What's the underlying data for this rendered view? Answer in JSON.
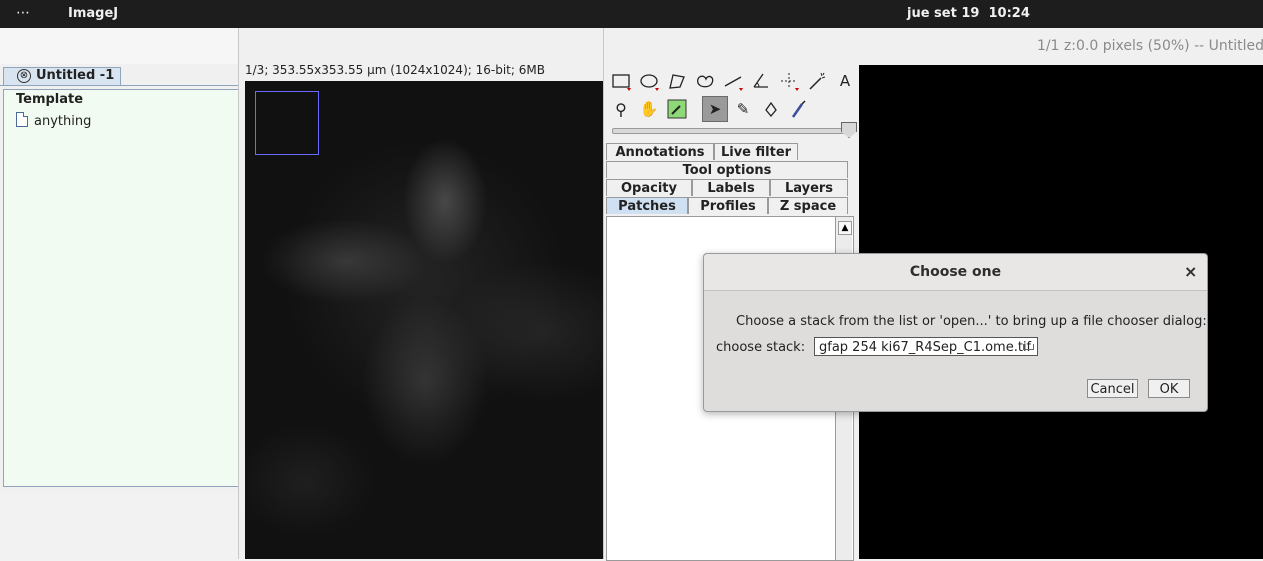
{
  "topbar": {
    "menu_glyph": "⋯",
    "app_name": "ImageJ",
    "datetime": "jue set 19  10:24"
  },
  "tree_window": {
    "tab": {
      "close_glyph": "⊗",
      "label": "Untitled -1"
    },
    "tree": {
      "root": "Template",
      "child": "anything"
    }
  },
  "image_window": {
    "info": "1/3; 353.55x353.55 µm (1024x1024); 16-bit; 6MB"
  },
  "display_window": {
    "status": "1/1 z:0.0 pixels  (50%) -- Untitled",
    "tool_glyphs": {
      "text": "A",
      "hand": "✋",
      "magnifier": "⚲",
      "arrow": "➤",
      "pen": "✎",
      "brush": "🖌"
    },
    "tabs": [
      {
        "label": "Annotations"
      },
      {
        "label": "Live filter"
      },
      {
        "label": "Tool options"
      },
      {
        "label": "Opacity"
      },
      {
        "label": "Labels"
      },
      {
        "label": "Layers"
      },
      {
        "label": "Patches"
      },
      {
        "label": "Profiles"
      },
      {
        "label": "Z space"
      }
    ],
    "scroll_up_glyph": "▲"
  },
  "dialog": {
    "title": "Choose one",
    "close_glyph": "×",
    "message": "Choose a stack from the list or 'open...' to bring up a file chooser dialog:",
    "field_label": "choose stack:",
    "selected_value": "gfap 254 ki67_R4Sep_C1.ome.tif",
    "cancel_label": "Cancel",
    "ok_label": "OK"
  },
  "colors": {
    "topbar": "#1d1d1d",
    "tree_bg": "#f1fbf1",
    "active_tab": "#cfe0f2",
    "roi": "#6a6aff"
  }
}
